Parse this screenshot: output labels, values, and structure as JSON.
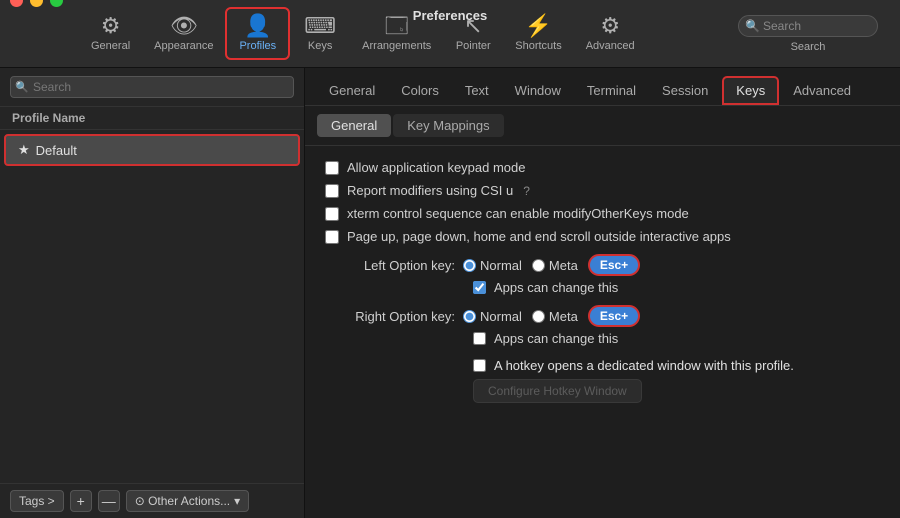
{
  "window": {
    "title": "Preferences"
  },
  "toolbar": {
    "items": [
      {
        "id": "general",
        "label": "General",
        "icon": "⚙"
      },
      {
        "id": "appearance",
        "label": "Appearance",
        "icon": "👁"
      },
      {
        "id": "profiles",
        "label": "Profiles",
        "icon": "👤",
        "active": true
      },
      {
        "id": "keys",
        "label": "Keys",
        "icon": "⌨"
      },
      {
        "id": "arrangements",
        "label": "Arrangements",
        "icon": "🗔"
      },
      {
        "id": "pointer",
        "label": "Pointer",
        "icon": "↖"
      },
      {
        "id": "shortcuts",
        "label": "Shortcuts",
        "icon": "⚡"
      },
      {
        "id": "advanced",
        "label": "Advanced",
        "icon": "⚙"
      }
    ],
    "search_placeholder": "Search"
  },
  "sidebar": {
    "search_placeholder": "Search",
    "header": "Profile Name",
    "profiles": [
      {
        "name": "Default",
        "is_default": true,
        "selected": true
      }
    ],
    "bottom": {
      "tags_label": "Tags >",
      "other_actions_label": "⊙ Other Actions...",
      "add_label": "+",
      "remove_label": "—"
    }
  },
  "tabs": [
    {
      "id": "general",
      "label": "General"
    },
    {
      "id": "colors",
      "label": "Colors"
    },
    {
      "id": "text",
      "label": "Text"
    },
    {
      "id": "window",
      "label": "Window"
    },
    {
      "id": "terminal",
      "label": "Terminal"
    },
    {
      "id": "session",
      "label": "Session"
    },
    {
      "id": "keys",
      "label": "Keys",
      "active": true
    },
    {
      "id": "advanced",
      "label": "Advanced"
    }
  ],
  "subtabs": [
    {
      "id": "general",
      "label": "General",
      "active": true
    },
    {
      "id": "keymappings",
      "label": "Key Mappings"
    }
  ],
  "content": {
    "checkboxes": [
      {
        "id": "allow-keypad",
        "label": "Allow application keypad mode",
        "checked": false
      },
      {
        "id": "report-modifiers",
        "label": "Report modifiers using CSI u",
        "checked": false,
        "has_info": true
      },
      {
        "id": "xterm-control",
        "label": "xterm control sequence can enable modifyOtherKeys mode",
        "checked": false
      },
      {
        "id": "page-scroll",
        "label": "Page up, page down, home and end scroll outside interactive apps",
        "checked": false
      }
    ],
    "left_option": {
      "label": "Left Option key:",
      "options": [
        "Normal",
        "Meta"
      ],
      "selected": "Normal",
      "esc_selected": true,
      "esc_label": "Esc+",
      "apps_can_change": true,
      "apps_can_change_label": "Apps can change this"
    },
    "right_option": {
      "label": "Right Option key:",
      "options": [
        "Normal",
        "Meta"
      ],
      "selected": "Normal",
      "esc_selected": true,
      "esc_label": "Esc+",
      "apps_can_change": false,
      "apps_can_change_label": "Apps can change this"
    },
    "hotkey": {
      "label": "A hotkey opens a dedicated window with this profile.",
      "checked": false,
      "configure_label": "Configure Hotkey Window"
    }
  }
}
